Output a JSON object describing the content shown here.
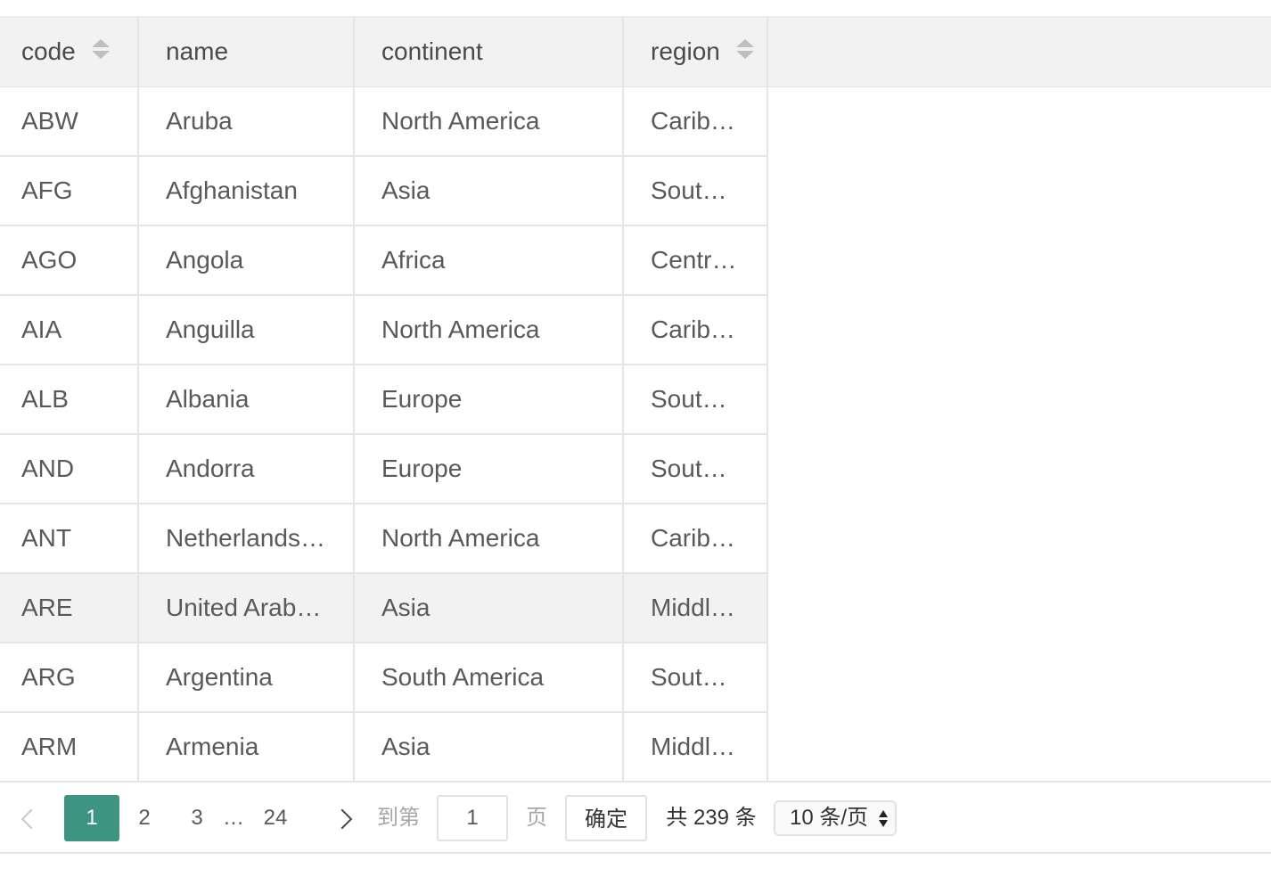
{
  "table": {
    "columns": [
      {
        "key": "code",
        "label": "code",
        "sortable": true
      },
      {
        "key": "name",
        "label": "name",
        "sortable": false
      },
      {
        "key": "continent",
        "label": "continent",
        "sortable": false
      },
      {
        "key": "region",
        "label": "region",
        "sortable": true
      }
    ],
    "rows": [
      {
        "code": "ABW",
        "name": "Aruba",
        "continent": "North America",
        "region": "Carib…"
      },
      {
        "code": "AFG",
        "name": "Afghanistan",
        "continent": "Asia",
        "region": "Sout…"
      },
      {
        "code": "AGO",
        "name": "Angola",
        "continent": "Africa",
        "region": "Centr…"
      },
      {
        "code": "AIA",
        "name": "Anguilla",
        "continent": "North America",
        "region": "Carib…"
      },
      {
        "code": "ALB",
        "name": "Albania",
        "continent": "Europe",
        "region": "Sout…"
      },
      {
        "code": "AND",
        "name": "Andorra",
        "continent": "Europe",
        "region": "Sout…"
      },
      {
        "code": "ANT",
        "name": "Netherlands…",
        "continent": "North America",
        "region": "Carib…"
      },
      {
        "code": "ARE",
        "name": "United Arab…",
        "continent": "Asia",
        "region": "Middl…"
      },
      {
        "code": "ARG",
        "name": "Argentina",
        "continent": "South America",
        "region": "Sout…"
      },
      {
        "code": "ARM",
        "name": "Armenia",
        "continent": "Asia",
        "region": "Middl…"
      }
    ],
    "hovered_row_index": 7
  },
  "pagination": {
    "pages": [
      "1",
      "2",
      "3"
    ],
    "ellipsis": "…",
    "last_page": "24",
    "current_page": "1",
    "goto_prefix": "到第",
    "goto_value": "1",
    "goto_suffix": "页",
    "confirm_label": "确定",
    "total_label": "共 239 条",
    "page_size_label": "10 条/页",
    "prev_icon": "chevron-left-icon",
    "next_icon": "chevron-right-icon"
  },
  "colors": {
    "accent": "#3d9483",
    "header_bg": "#f2f2f2",
    "hover_row_bg": "#f2f2f2"
  }
}
